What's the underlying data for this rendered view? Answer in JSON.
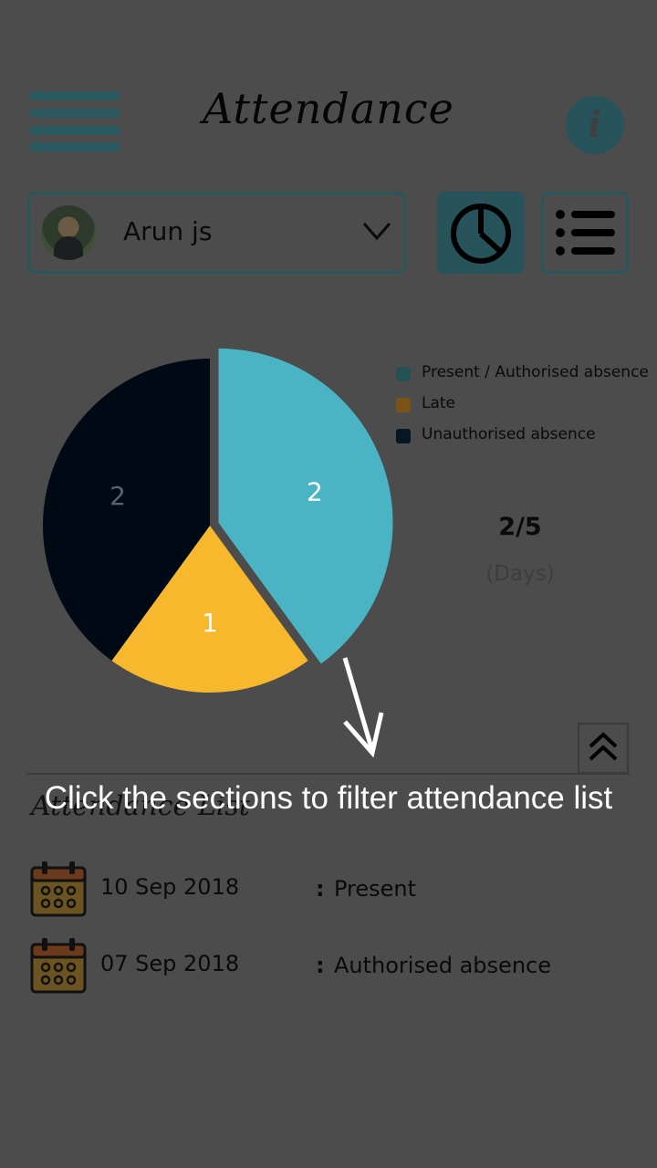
{
  "header": {
    "title": "Attendance",
    "info_icon_glyph": "i"
  },
  "student": {
    "name": "Arun js",
    "avatar_icon": "avatar-photo",
    "dropdown_icon": "chevron-down-icon"
  },
  "view_tabs": {
    "chart_icon": "pie-chart-icon",
    "list_icon": "list-icon",
    "active": "chart"
  },
  "chart_data": {
    "type": "pie",
    "slices": [
      {
        "label": "Present / Authorised absence",
        "value": 2,
        "color": "#4ab4c4",
        "legend_color": "#245254",
        "exploded": true
      },
      {
        "label": "Late",
        "value": 1,
        "color": "#f8b82d",
        "legend_color": "#7a5416"
      },
      {
        "label": "Unauthorised absence",
        "value": 2,
        "color": "#000a14",
        "legend_color": "#071623"
      }
    ],
    "value_labels": [
      "2",
      "1",
      "2"
    ]
  },
  "summary": {
    "ratio": "2/5",
    "unit": "(Days)"
  },
  "hint": {
    "text": "Click the sections to filter attendance list"
  },
  "list": {
    "title": "Attendance List",
    "collapse_icon": "double-chevron-up-icon",
    "rows": [
      {
        "date": "10 Sep 2018",
        "colon": ":",
        "status": "Present"
      },
      {
        "date": "07 Sep 2018",
        "colon": ":",
        "status": "Authorised absence"
      }
    ]
  },
  "colors": {
    "overlay_background": "#4c4c4c",
    "accent_teal": "#26545a"
  }
}
